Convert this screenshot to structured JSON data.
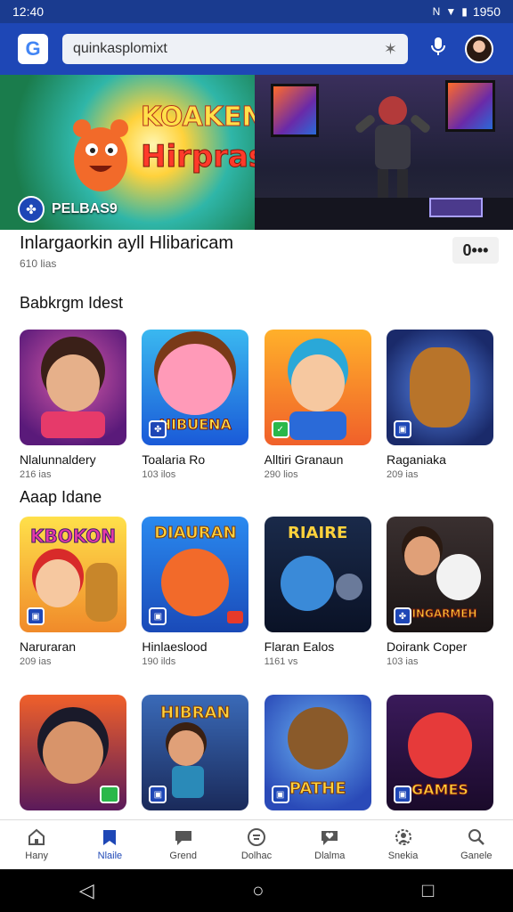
{
  "status": {
    "time": "12:40",
    "battery": "1950"
  },
  "search": {
    "query": "quinkasplomixt"
  },
  "banner": {
    "left_title_1": "KOAKEN",
    "left_title_2": "Hirpras!",
    "left_badge": "PELBAS9"
  },
  "app": {
    "title": "Inlargaorkin ayll Hlibaricam",
    "subtitle": "610 lias",
    "more": "0•••"
  },
  "sections": [
    {
      "title": "Babkrgm Idest",
      "items": [
        {
          "name": "Nlalunnaldery",
          "meta": "216 ias",
          "word": ""
        },
        {
          "name": "Toalaria Ro",
          "meta": "103 ilos",
          "word": "HIBUENA"
        },
        {
          "name": "Alltiri Granaun",
          "meta": "290 lios",
          "word": ""
        },
        {
          "name": "Raganiaka",
          "meta": "209 ias",
          "word": ""
        }
      ]
    },
    {
      "title": "Aaap Idane",
      "items": [
        {
          "name": "Naruraran",
          "meta": "209 ias",
          "word": "KBOKON"
        },
        {
          "name": "Hinlaeslood",
          "meta": "190 ilds",
          "word": "DIAURAN"
        },
        {
          "name": "Flaran Ealos",
          "meta": "1161 vs",
          "word": "RIAIRE"
        },
        {
          "name": "Doirank Coper",
          "meta": "103 ias",
          "word": "NINGARMEH"
        }
      ]
    },
    {
      "title": "",
      "items": [
        {
          "name": "",
          "meta": "",
          "word": ""
        },
        {
          "name": "",
          "meta": "",
          "word": "HIBRAN"
        },
        {
          "name": "",
          "meta": "",
          "word": "PATHE"
        },
        {
          "name": "",
          "meta": "",
          "word": "GAMES"
        }
      ]
    }
  ],
  "nav": [
    {
      "label": "Hany",
      "icon": "home-icon"
    },
    {
      "label": "Nlaile",
      "icon": "bookmark-icon"
    },
    {
      "label": "Grend",
      "icon": "chat-icon"
    },
    {
      "label": "Dolhac",
      "icon": "coin-icon"
    },
    {
      "label": "Dlalma",
      "icon": "heart-chat-icon"
    },
    {
      "label": "Snekia",
      "icon": "settings-person-icon"
    },
    {
      "label": "Ganele",
      "icon": "search-icon"
    }
  ],
  "colors": {
    "brand": "#1e47b6",
    "statusbar": "#1a3b8f"
  }
}
